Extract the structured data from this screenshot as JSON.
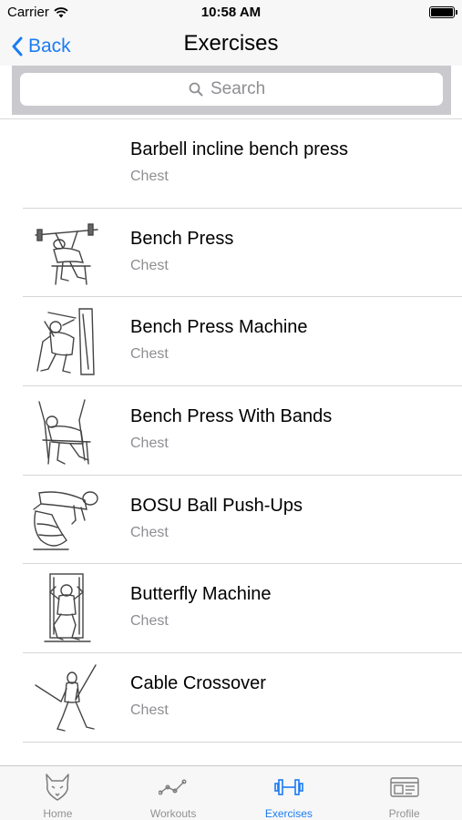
{
  "status_bar": {
    "carrier": "Carrier",
    "time": "10:58 AM"
  },
  "nav": {
    "back_label": "Back",
    "title": "Exercises"
  },
  "search": {
    "placeholder": "Search"
  },
  "exercises": [
    {
      "name": "Barbell incline bench press",
      "muscle": "Chest",
      "thumb": "none"
    },
    {
      "name": "Bench Press",
      "muscle": "Chest",
      "thumb": "bench-press-illustration"
    },
    {
      "name": "Bench Press Machine",
      "muscle": "Chest",
      "thumb": "bench-press-machine-illustration"
    },
    {
      "name": "Bench Press With Bands",
      "muscle": "Chest",
      "thumb": "bench-press-bands-illustration"
    },
    {
      "name": "BOSU Ball Push-Ups",
      "muscle": "Chest",
      "thumb": "bosu-pushup-illustration"
    },
    {
      "name": "Butterfly Machine",
      "muscle": "Chest",
      "thumb": "butterfly-machine-illustration"
    },
    {
      "name": "Cable Crossover",
      "muscle": "Chest",
      "thumb": "cable-crossover-illustration"
    }
  ],
  "tabs": [
    {
      "label": "Home",
      "icon": "wolf-icon",
      "active": false
    },
    {
      "label": "Workouts",
      "icon": "graph-icon",
      "active": false
    },
    {
      "label": "Exercises",
      "icon": "dumbbell-icon",
      "active": true
    },
    {
      "label": "Profile",
      "icon": "id-card-icon",
      "active": false
    }
  ],
  "colors": {
    "accent": "#1a7cf5",
    "inactive": "#929292",
    "subtitle": "#8e8e93"
  }
}
